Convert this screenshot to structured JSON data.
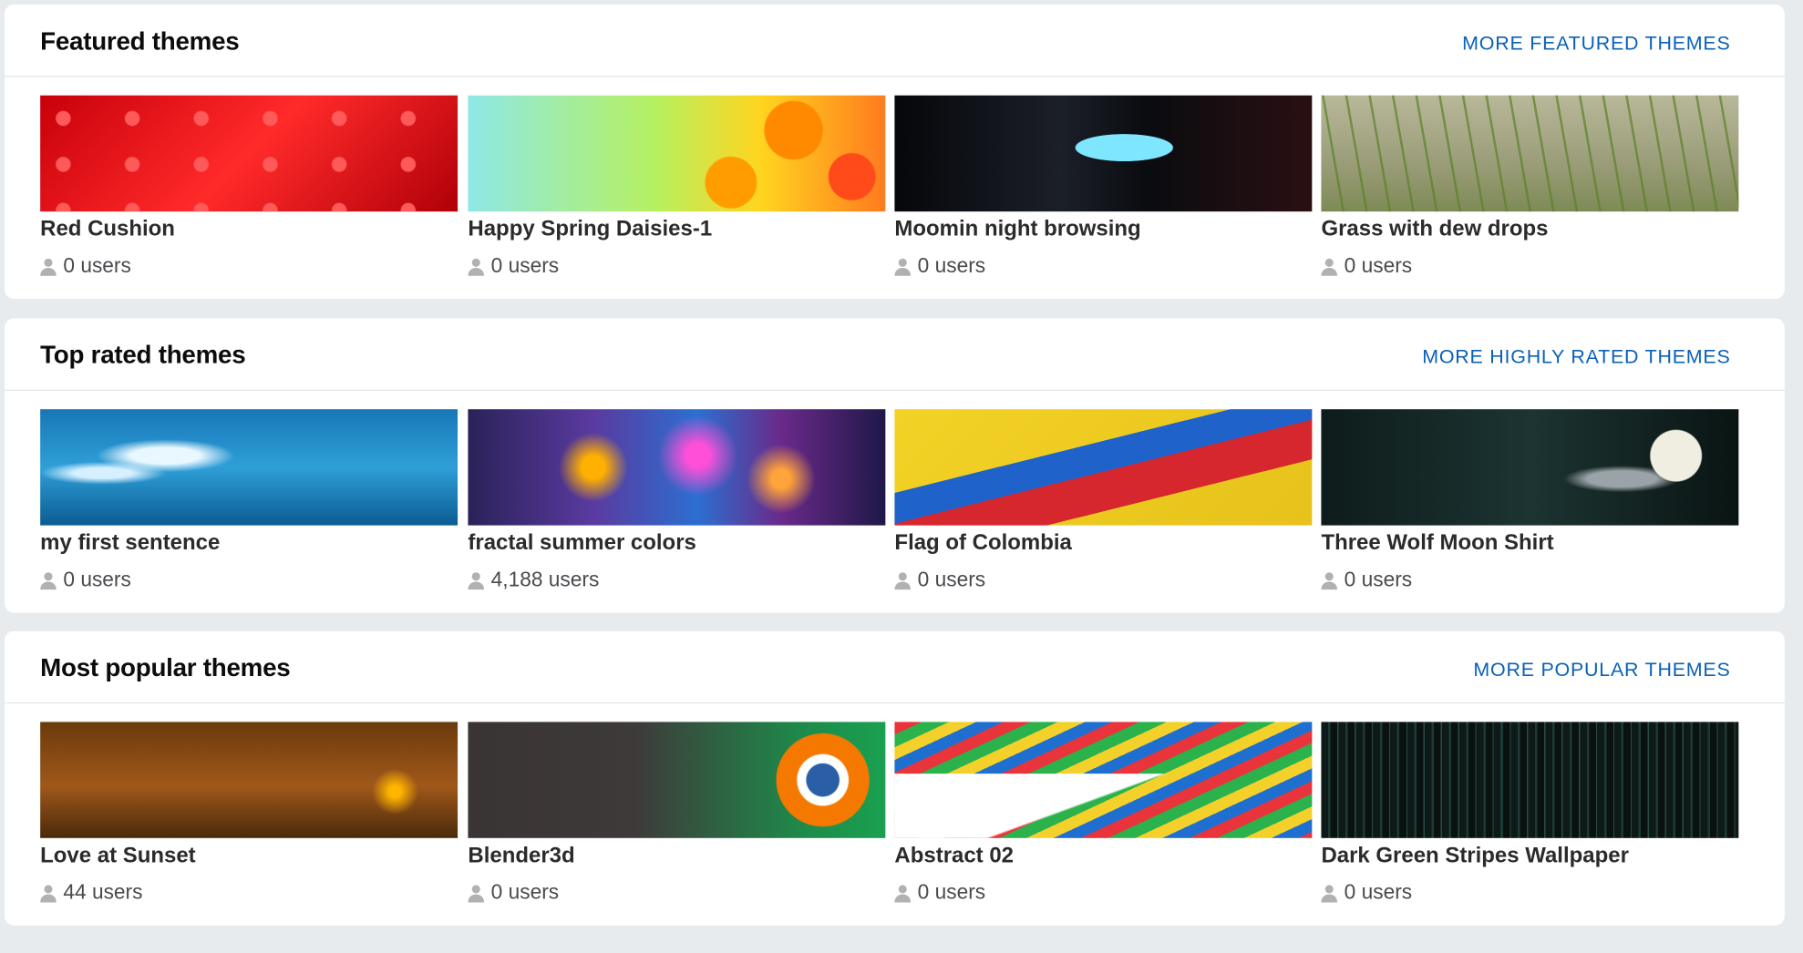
{
  "sections": [
    {
      "title": "Featured themes",
      "more_label": "MORE FEATURED THEMES",
      "themes": [
        {
          "name": "Red Cushion",
          "users": "0 users"
        },
        {
          "name": "Happy Spring Daisies-1",
          "users": "0 users"
        },
        {
          "name": "Moomin night browsing",
          "users": "0 users"
        },
        {
          "name": "Grass with dew drops",
          "users": "0 users"
        }
      ]
    },
    {
      "title": "Top rated themes",
      "more_label": "MORE HIGHLY RATED THEMES",
      "themes": [
        {
          "name": "my first sentence",
          "users": "0 users"
        },
        {
          "name": "fractal summer colors",
          "users": "4,188 users"
        },
        {
          "name": "Flag of Colombia",
          "users": "0 users"
        },
        {
          "name": "Three Wolf Moon Shirt",
          "users": "0 users"
        }
      ]
    },
    {
      "title": "Most popular themes",
      "more_label": "MORE POPULAR THEMES",
      "themes": [
        {
          "name": "Love at Sunset",
          "users": "44 users"
        },
        {
          "name": "Blender3d",
          "users": "0 users"
        },
        {
          "name": "Abstract 02",
          "users": "0 users"
        },
        {
          "name": "Dark Green Stripes Wallpaper",
          "users": "0 users"
        }
      ]
    }
  ],
  "colors": {
    "link": "#0a61b8",
    "page_background": "#e8ebee",
    "card_background": "#ffffff"
  },
  "icons": {
    "users": "user-icon"
  }
}
